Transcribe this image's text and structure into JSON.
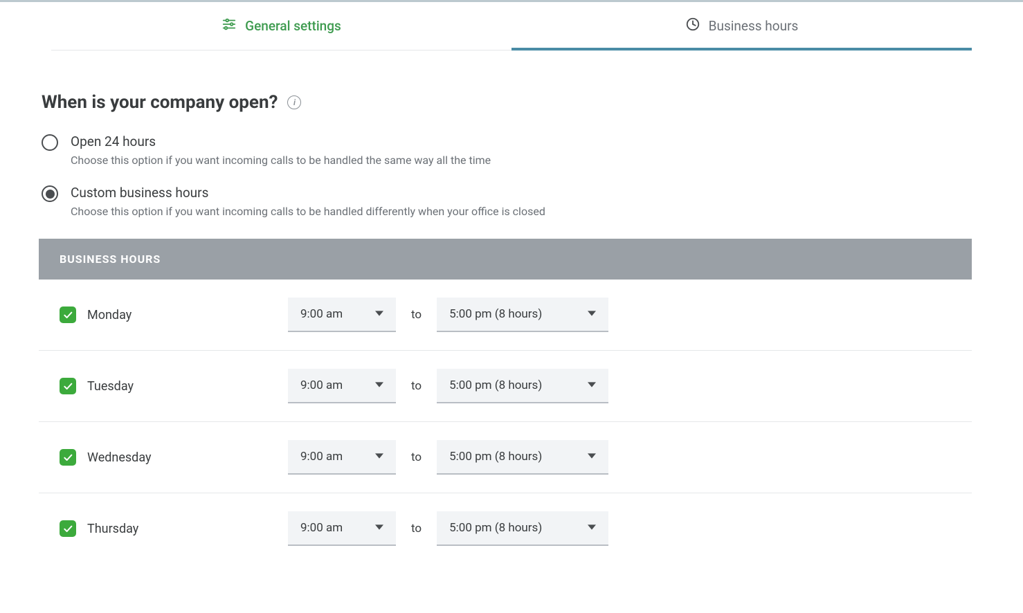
{
  "tabs": {
    "general": "General settings",
    "business_hours": "Business hours"
  },
  "heading": "When is your company open?",
  "options": {
    "open24": {
      "label": "Open 24 hours",
      "desc": "Choose this option if you want incoming calls to be handled the same way all the time"
    },
    "custom": {
      "label": "Custom business hours",
      "desc": "Choose this option if you want incoming calls to be handled differently when your office is closed"
    }
  },
  "panel_header": "BUSINESS HOURS",
  "to_label": "to",
  "rows": [
    {
      "day": "Monday",
      "start": "9:00 am",
      "end": "5:00 pm (8 hours)"
    },
    {
      "day": "Tuesday",
      "start": "9:00 am",
      "end": "5:00 pm (8 hours)"
    },
    {
      "day": "Wednesday",
      "start": "9:00 am",
      "end": "5:00 pm (8 hours)"
    },
    {
      "day": "Thursday",
      "start": "9:00 am",
      "end": "5:00 pm (8 hours)"
    }
  ]
}
